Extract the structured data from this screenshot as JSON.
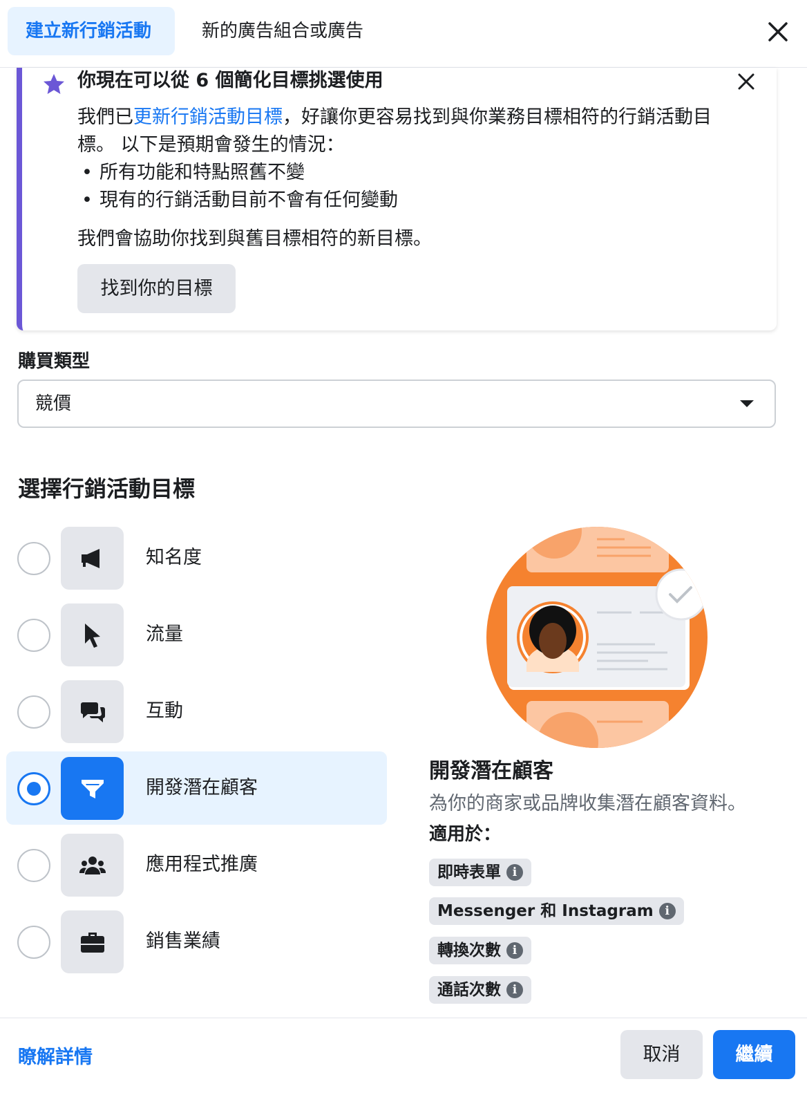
{
  "header": {
    "tabs": [
      {
        "label": "建立新行銷活動",
        "active": true
      },
      {
        "label": "新的廣告組合或廣告",
        "active": false
      }
    ],
    "close_icon": "close-icon"
  },
  "notice": {
    "accent_color": "#6b57d6",
    "title": "你現在可以從 6 個簡化目標挑選使用",
    "body_prefix": "我們已",
    "body_link": "更新行銷活動目標",
    "body_suffix": "，好讓你更容易找到與你業務目標相符的行銷活動目標。 以下是預期會發生的情況：",
    "bullets": [
      "所有功能和特點照舊不變",
      "現有的行銷活動目前不會有任何變動"
    ],
    "footer_text": "我們會協助你找到與舊目標相符的新目標。",
    "button_label": "找到你的目標"
  },
  "buying_type": {
    "label": "購買類型",
    "selected": "競價"
  },
  "objectives": {
    "section_title": "選擇行銷活動目標",
    "items": [
      {
        "label": "知名度",
        "icon": "megaphone-icon",
        "selected": false
      },
      {
        "label": "流量",
        "icon": "cursor-icon",
        "selected": false
      },
      {
        "label": "互動",
        "icon": "chat-bubbles-icon",
        "selected": false
      },
      {
        "label": "開發潛在顧客",
        "icon": "funnel-icon",
        "selected": true
      },
      {
        "label": "應用程式推廣",
        "icon": "people-icon",
        "selected": false
      },
      {
        "label": "銷售業績",
        "icon": "briefcase-icon",
        "selected": false
      }
    ]
  },
  "description": {
    "title": "開發潛在顧客",
    "text": "為你的商家或品牌收集潛在顧客資料。",
    "applies_label": "適用於：",
    "chips": [
      "即時表單",
      "Messenger 和 Instagram",
      "轉換次數",
      "通話次數"
    ]
  },
  "footer": {
    "learn_more": "瞭解詳情",
    "cancel": "取消",
    "continue": "繼續"
  },
  "colors": {
    "primary": "#1877f2",
    "selected_bg": "#e7f3ff",
    "illustration_orange": "#f5822f"
  }
}
